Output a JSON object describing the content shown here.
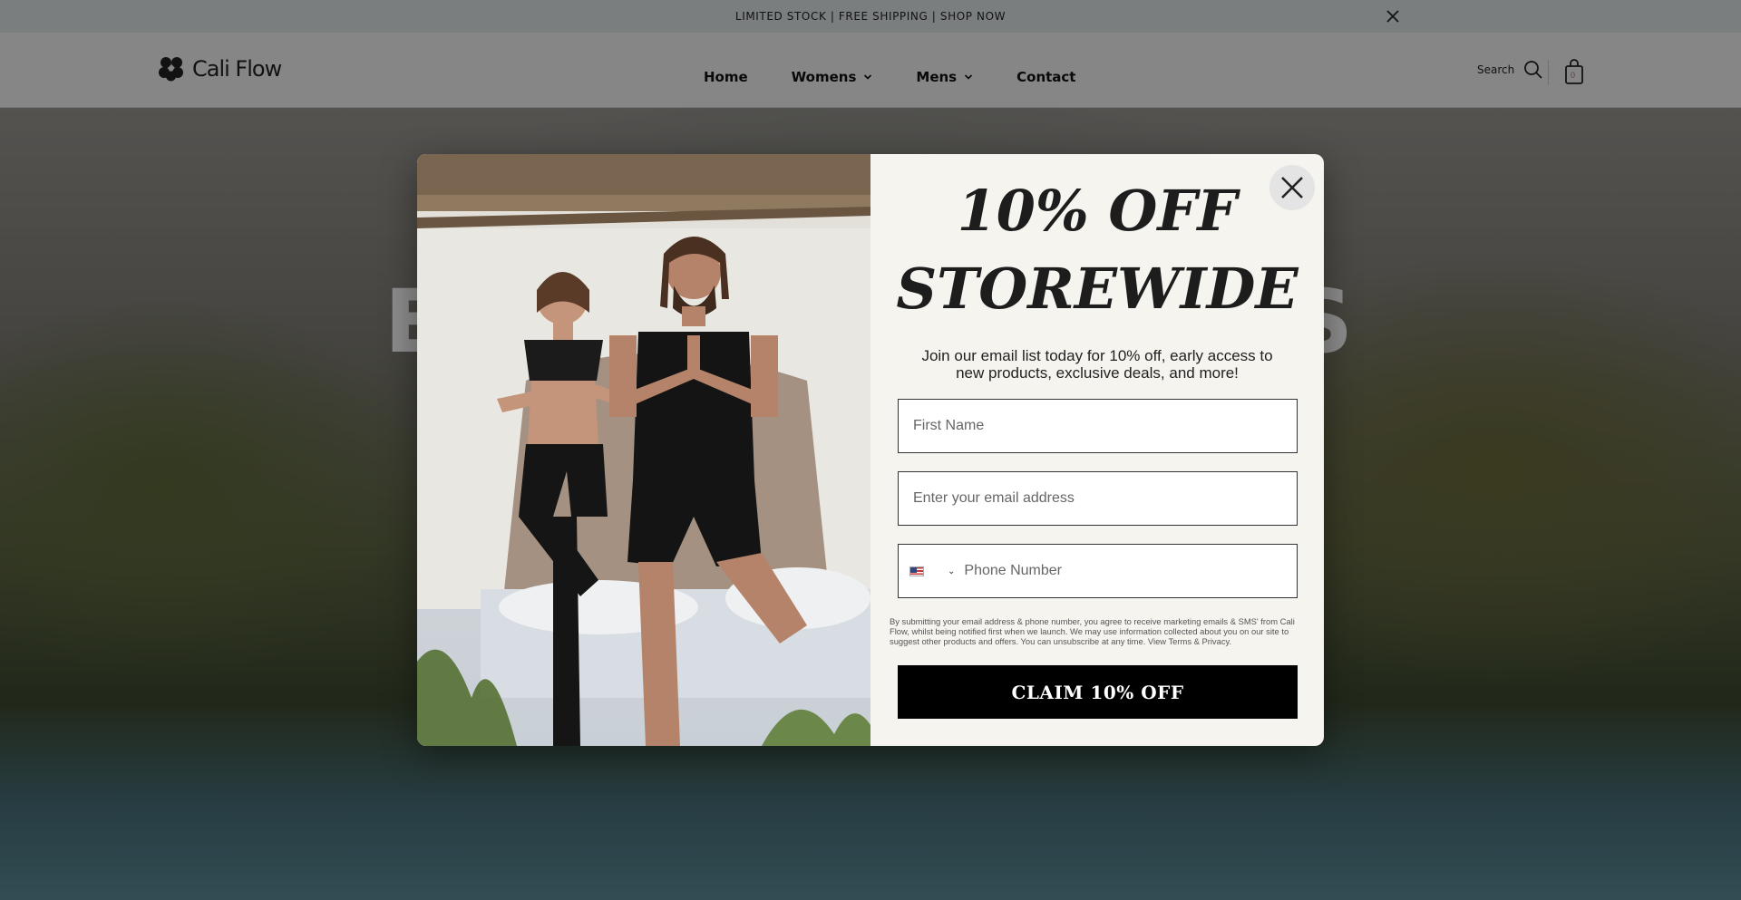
{
  "announcement": {
    "text": "LIMITED STOCK | FREE SHIPPING |  SHOP NOW"
  },
  "header": {
    "logo_text": "Cali Flow",
    "nav": [
      {
        "label": "Home",
        "dropdown": false
      },
      {
        "label": "Womens",
        "dropdown": true
      },
      {
        "label": "Mens",
        "dropdown": true
      },
      {
        "label": "Contact",
        "dropdown": false
      }
    ],
    "search_label": "Search",
    "cart_count": "0"
  },
  "hero": {
    "title": "ELIMINATE TOXINS"
  },
  "popup": {
    "headline_line1": "10% OFF",
    "headline_line2": "STOREWIDE",
    "subtext": "Join our email list today for 10% off, early access to new products, exclusive deals, and more!",
    "first_name_placeholder": "First Name",
    "email_placeholder": "Enter your email address",
    "phone_placeholder": "Phone Number",
    "legal": "By submitting your email address & phone number, you agree to receive marketing emails & SMS' from Cali Flow, whilst being notified first when we launch. We may use information collected about you on our site to suggest other products and offers. You can unsubscribe at any time. View Terms & Privacy.",
    "cta_label": "CLAIM 10% OFF"
  }
}
